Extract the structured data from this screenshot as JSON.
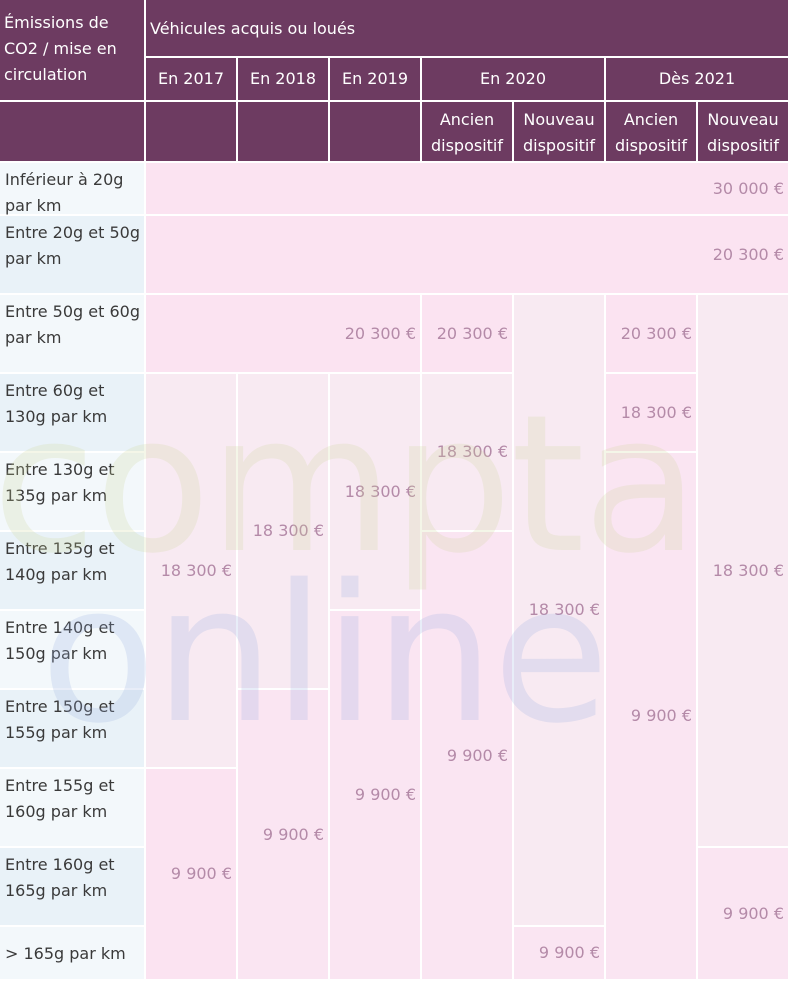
{
  "header": {
    "corner": "Émissions de CO2 / mise en circulation",
    "group": "Véhicules acquis ou loués",
    "years": [
      "En 2017",
      "En 2018",
      "En 2019",
      "En 2020",
      "Dès 2021"
    ],
    "sub_2020": [
      "Ancien dispositif",
      "Nouveau dispositif"
    ],
    "sub_2021": [
      "Ancien dispositif",
      "Nouveau dispositif"
    ]
  },
  "rows": [
    "Inférieur à 20g par km",
    "Entre 20g et 50g par km",
    "Entre 50g et 60g par km",
    "Entre 60g et 130g par km",
    "Entre 130g et 135g par km",
    "Entre 135g et 140g par km",
    "Entre 140g et 150g par km",
    "Entre 150g et 155g par km",
    "Entre 155g et 160g par km",
    "Entre 160g et 165g par km",
    "> 165g par km"
  ],
  "values": {
    "r0_all": "30 000 €",
    "r1_all": "20 300 €",
    "r2_2017_2019": "20 300 €",
    "r2_2020_old": "20 300 €",
    "r2_2021_old": "20 300 €",
    "c2017_high": "18 300 €",
    "c2017_low": "9 900 €",
    "c2018_high": "18 300 €",
    "c2018_low": "9 900 €",
    "c2019_high": "18 300 €",
    "c2019_low": "9 900 €",
    "c2020_old_high": "18 300 €",
    "c2020_old_low": "9 900 €",
    "c2020_new_high": "18 300 €",
    "c2020_new_low": "9 900 €",
    "c2021_old_mid": "18 300 €",
    "c2021_old_low": "9 900 €",
    "c2021_new_high": "18 300 €",
    "c2021_new_low": "9 900 €"
  },
  "watermark": {
    "line1": "compta",
    "line2": "online"
  }
}
